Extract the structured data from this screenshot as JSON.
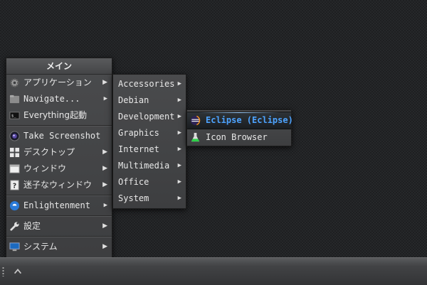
{
  "main_menu": {
    "title": "メイン",
    "items": [
      {
        "label": "アプリケーション",
        "icon": "gear-icon"
      },
      {
        "label": "Navigate...",
        "icon": "folder-icon"
      },
      {
        "label": "Everything起動",
        "icon": "terminal-icon"
      },
      {
        "label": "Take Screenshot",
        "icon": "camera-icon"
      },
      {
        "label": "デスクトップ",
        "icon": "desktop-grid-icon"
      },
      {
        "label": "ウィンドウ",
        "icon": "window-icon"
      },
      {
        "label": "迷子なウィンドウ",
        "icon": "question-icon"
      },
      {
        "label": "Enlightenment",
        "icon": "enlightenment-icon"
      },
      {
        "label": "設定",
        "icon": "wrench-icon"
      },
      {
        "label": "システム",
        "icon": "computer-icon"
      }
    ]
  },
  "apps_menu": {
    "items": [
      {
        "label": "Accessories"
      },
      {
        "label": "Debian"
      },
      {
        "label": "Development"
      },
      {
        "label": "Graphics"
      },
      {
        "label": "Internet"
      },
      {
        "label": "Multimedia"
      },
      {
        "label": "Office"
      },
      {
        "label": "System"
      }
    ]
  },
  "dev_menu": {
    "items": [
      {
        "label": "Eclipse (Eclipse)",
        "icon": "eclipse-icon",
        "selected": true
      },
      {
        "label": "Icon Browser",
        "icon": "flask-icon"
      }
    ]
  },
  "shelf": {
    "up_icon": "chevron-up-icon"
  },
  "colors": {
    "selected_text": "#4da3ff",
    "menu_bg": "#444547",
    "desktop_bg": "#26282a"
  }
}
